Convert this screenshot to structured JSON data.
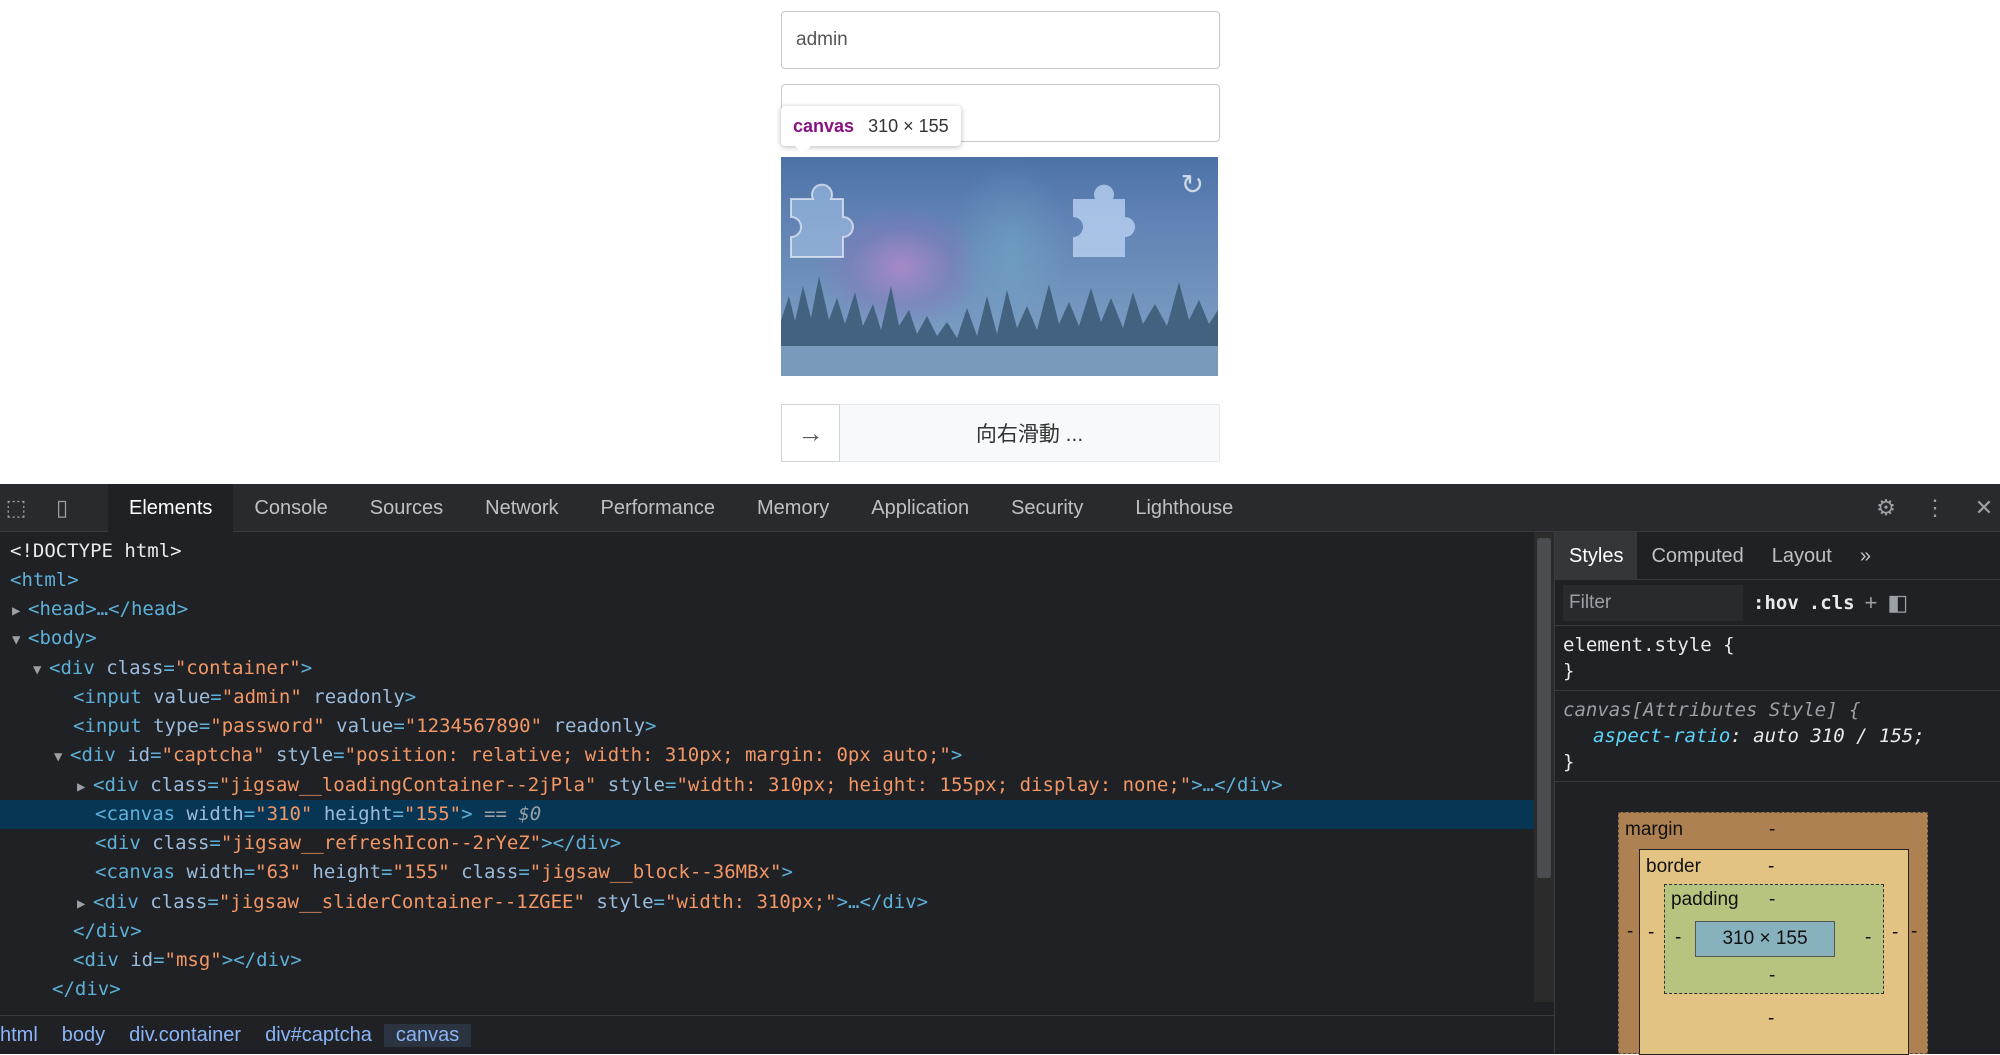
{
  "page": {
    "username_value": "admin",
    "password_value": "",
    "tooltip": {
      "tag": "canvas",
      "size": "310 × 155"
    },
    "slider_label": "向右滑動 ...",
    "slider_arrow": "→"
  },
  "devtools": {
    "tabs": [
      "Elements",
      "Console",
      "Sources",
      "Network",
      "Performance",
      "Memory",
      "Application",
      "Security",
      "Lighthouse"
    ],
    "active_tab": "Elements",
    "dom_lines": [
      "<!DOCTYPE html>",
      "<html>",
      "<head>…</head>",
      "<body>",
      "<div class=\"container\">",
      "<input value=\"admin\" readonly>",
      "<input type=\"password\" value=\"1234567890\" readonly>",
      "<div id=\"captcha\" style=\"position: relative; width: 310px; margin: 0px auto;\">",
      "<div class=\"jigsaw__loadingContainer--2jPla\" style=\"width: 310px; height: 155px; display: none;\">…</div>",
      "<canvas width=\"310\" height=\"155\"> == $0",
      "<div class=\"jigsaw__refreshIcon--2rYeZ\"></div>",
      "<canvas width=\"63\" height=\"155\" class=\"jigsaw__block--36MBx\">",
      "<div class=\"jigsaw__sliderContainer--1ZGEE\" style=\"width: 310px;\">…</div>",
      "</div>",
      "<div id=\"msg\"></div>",
      "</div>"
    ],
    "breadcrumb": [
      "html",
      "body",
      "div.container",
      "div#captcha",
      "canvas"
    ],
    "styles_tabs": [
      "Styles",
      "Computed",
      "Layout",
      "»"
    ],
    "filter_placeholder": "Filter",
    "filter_hov": ":hov",
    "filter_cls": ".cls",
    "element_style_selector": "element.style {",
    "close_brace": "}",
    "attr_rule_selector": "canvas[Attributes Style] {",
    "attr_rule_prop": "aspect-ratio",
    "attr_rule_value": "auto 310 / 155;",
    "box_model": {
      "margin_label": "margin",
      "border_label": "border",
      "padding_label": "padding",
      "dash": "-",
      "content_size": "310 × 155"
    }
  },
  "colors": {
    "selected_row": "#073655",
    "tag": "#5db0d7",
    "attr_name": "#9bbbdc",
    "attr_value": "#f29766"
  }
}
